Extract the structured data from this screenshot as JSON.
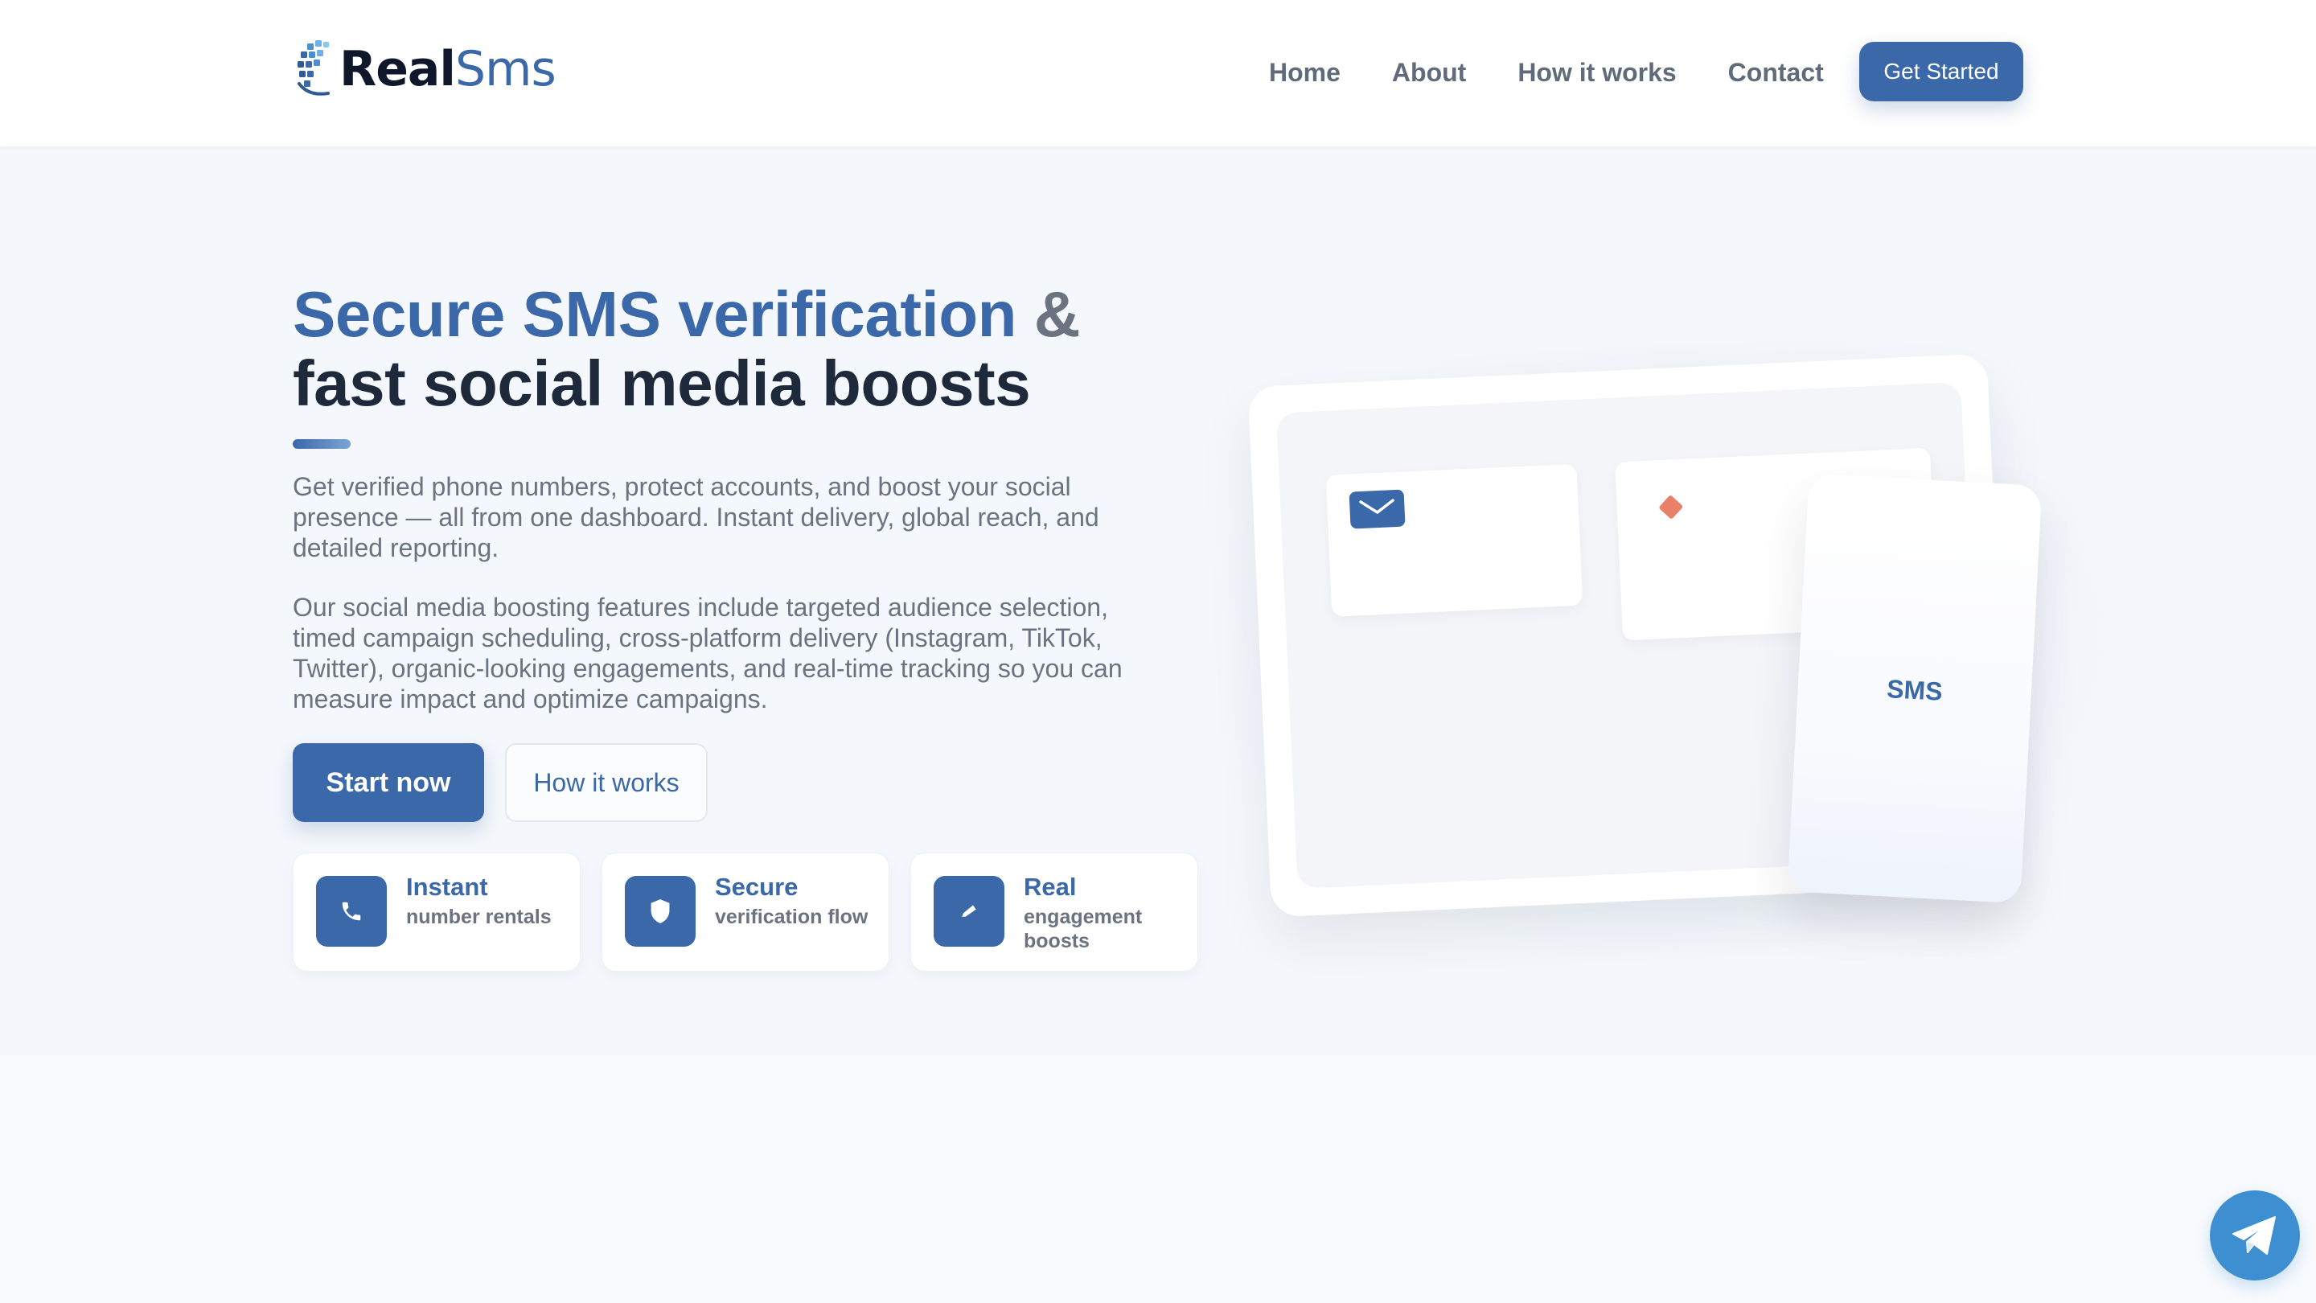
{
  "brand": {
    "name_part1": "Real",
    "name_part2": "Sms",
    "logo_icon": "globe-logo-icon",
    "accent_color": "#3a68a8"
  },
  "nav": {
    "links": [
      "Home",
      "About",
      "How it works",
      "Contact"
    ],
    "cta_label": "Get Started"
  },
  "hero": {
    "title_blue": "Secure SMS verification",
    "title_amp": "&",
    "title_dark": "fast social media boosts",
    "paragraph1": "Get verified phone numbers, protect accounts, and boost your social presence — all from one dashboard. Instant delivery, global reach, and detailed reporting.",
    "paragraph2": "Our social media boosting features include targeted audience selection, timed campaign scheduling, cross-platform delivery (Instagram, TikTok, Twitter), organic-looking engagements, and real-time tracking so you can measure impact and optimize campaigns.",
    "primary_button": "Start now",
    "secondary_button": "How it works"
  },
  "features": [
    {
      "title": "Instant",
      "subtitle": "number rentals",
      "icon": "phone-icon"
    },
    {
      "title": "Secure",
      "subtitle": "verification flow",
      "icon": "shield-icon"
    },
    {
      "title": "Real",
      "subtitle": "engagement boosts",
      "icon": "pen-icon"
    }
  ],
  "illustration": {
    "phone_label": "SMS",
    "card_icons": [
      "mail-icon",
      "diamond-icon"
    ]
  },
  "floating": {
    "icon": "telegram-icon",
    "color": "#3d8fd1"
  }
}
